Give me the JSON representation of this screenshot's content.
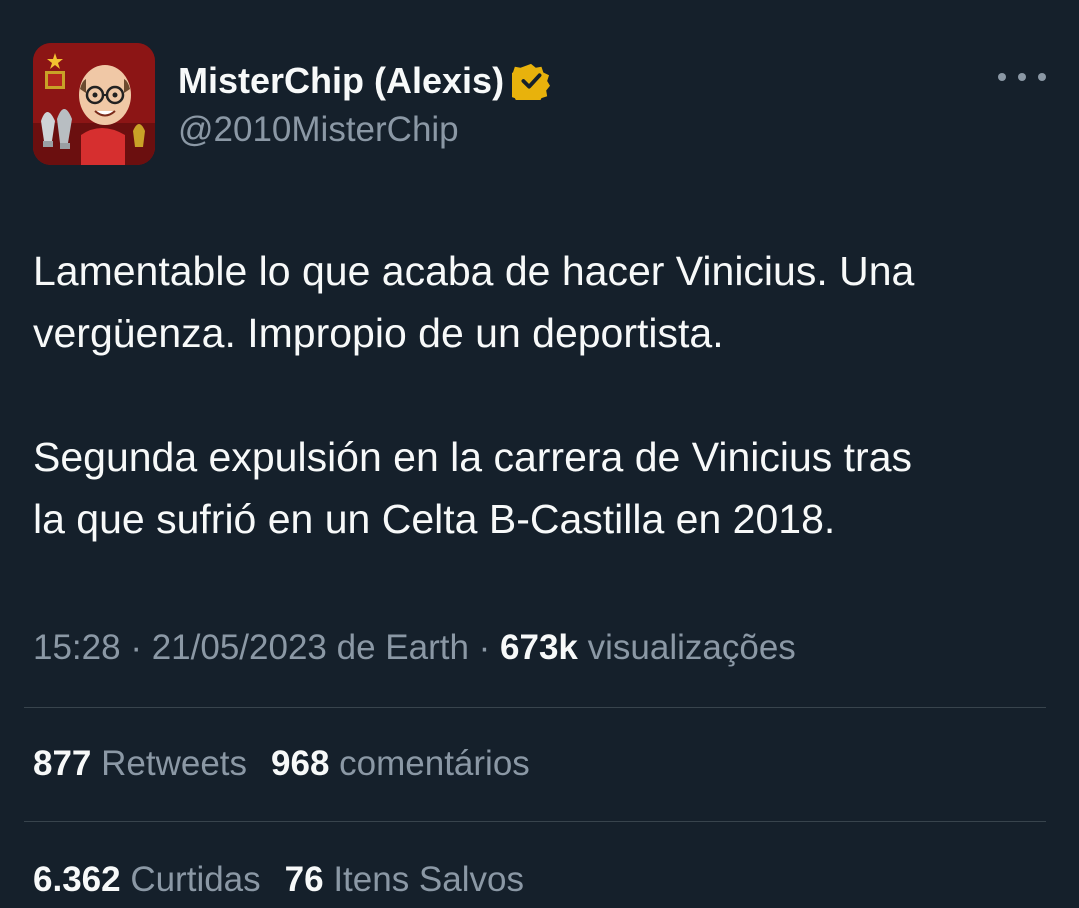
{
  "author": {
    "display_name": "MisterChip (Alexis)",
    "handle": "@2010MisterChip",
    "verified_color": "#e8b20c",
    "avatar_icon": "caricature-avatar"
  },
  "tweet": {
    "line1": "Lamentable lo que acaba de hacer Vinicius. Una",
    "line2": "vergüenza. Impropio de un deportista.",
    "line3": "Segunda expulsión en la carrera de Vinicius tras",
    "line4": "la que sufrió en un Celta B-Castilla en 2018."
  },
  "meta": {
    "time": "15:28",
    "separator1": " · ",
    "date_source": "21/05/2023 de Earth",
    "separator2": " · ",
    "views_count": "673k",
    "views_label": " visualizações"
  },
  "stats": {
    "retweets_count": "877",
    "retweets_label": " Retweets",
    "comments_count": "968",
    "comments_label": " comentários",
    "likes_count": "6.362",
    "likes_label": " Curtidas",
    "saves_count": "76",
    "saves_label": " Itens Salvos"
  },
  "colors": {
    "background": "#15202b",
    "secondary_text": "#8b98a5",
    "primary_text": "#f7f9f9",
    "divider": "#38444d"
  }
}
